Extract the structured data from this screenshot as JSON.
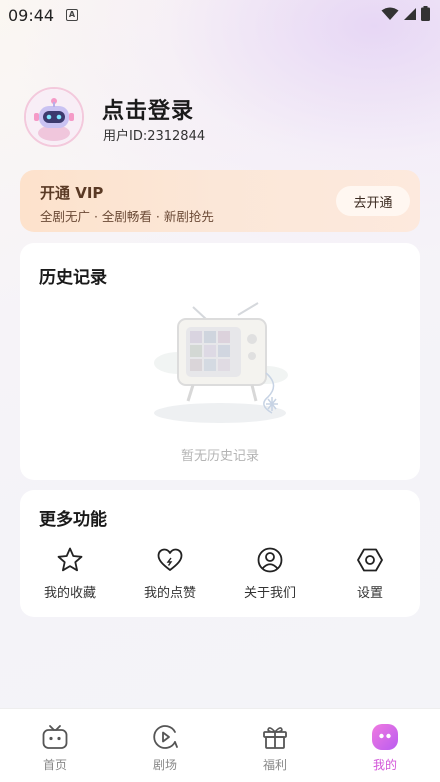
{
  "status_bar": {
    "time": "09:44",
    "notification_letter": "A"
  },
  "profile": {
    "login_title": "点击登录",
    "user_id": "用户ID:2312844"
  },
  "vip": {
    "title": "开通 VIP",
    "subtitle": "全剧无广 · 全剧畅看 · 新剧抢先",
    "button_label": "去开通"
  },
  "history": {
    "title": "历史记录",
    "empty_text": "暂无历史记录"
  },
  "more_functions": {
    "title": "更多功能",
    "items": [
      {
        "label": "我的收藏",
        "icon": "star-icon"
      },
      {
        "label": "我的点赞",
        "icon": "heart-icon"
      },
      {
        "label": "关于我们",
        "icon": "user-circle-icon"
      },
      {
        "label": "设置",
        "icon": "hexagon-settings-icon"
      }
    ]
  },
  "bottom_nav": {
    "active_color": "#d254d8",
    "items": [
      {
        "label": "首页",
        "icon": "tv-home-icon"
      },
      {
        "label": "剧场",
        "icon": "theater-icon"
      },
      {
        "label": "福利",
        "icon": "gift-icon"
      },
      {
        "label": "我的",
        "icon": "profile-face-icon",
        "active": true
      }
    ]
  }
}
